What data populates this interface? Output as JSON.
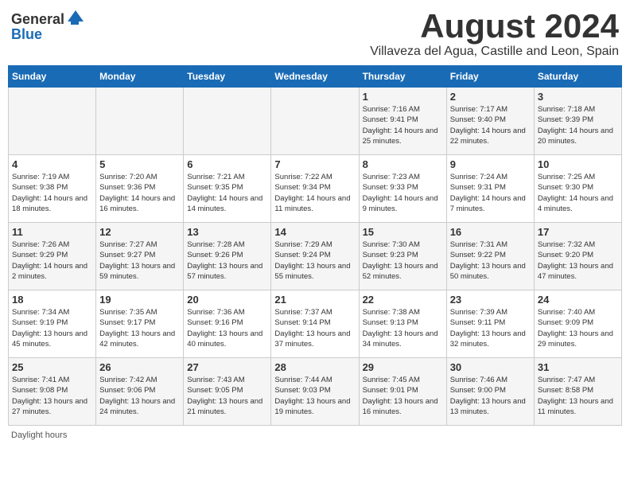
{
  "header": {
    "logo": {
      "general": "General",
      "blue": "Blue"
    },
    "title": "August 2024",
    "location": "Villaveza del Agua, Castille and Leon, Spain"
  },
  "calendar": {
    "days_of_week": [
      "Sunday",
      "Monday",
      "Tuesday",
      "Wednesday",
      "Thursday",
      "Friday",
      "Saturday"
    ],
    "weeks": [
      [
        {
          "day": "",
          "info": ""
        },
        {
          "day": "",
          "info": ""
        },
        {
          "day": "",
          "info": ""
        },
        {
          "day": "",
          "info": ""
        },
        {
          "day": "1",
          "info": "Sunrise: 7:16 AM\nSunset: 9:41 PM\nDaylight: 14 hours and 25 minutes."
        },
        {
          "day": "2",
          "info": "Sunrise: 7:17 AM\nSunset: 9:40 PM\nDaylight: 14 hours and 22 minutes."
        },
        {
          "day": "3",
          "info": "Sunrise: 7:18 AM\nSunset: 9:39 PM\nDaylight: 14 hours and 20 minutes."
        }
      ],
      [
        {
          "day": "4",
          "info": "Sunrise: 7:19 AM\nSunset: 9:38 PM\nDaylight: 14 hours and 18 minutes."
        },
        {
          "day": "5",
          "info": "Sunrise: 7:20 AM\nSunset: 9:36 PM\nDaylight: 14 hours and 16 minutes."
        },
        {
          "day": "6",
          "info": "Sunrise: 7:21 AM\nSunset: 9:35 PM\nDaylight: 14 hours and 14 minutes."
        },
        {
          "day": "7",
          "info": "Sunrise: 7:22 AM\nSunset: 9:34 PM\nDaylight: 14 hours and 11 minutes."
        },
        {
          "day": "8",
          "info": "Sunrise: 7:23 AM\nSunset: 9:33 PM\nDaylight: 14 hours and 9 minutes."
        },
        {
          "day": "9",
          "info": "Sunrise: 7:24 AM\nSunset: 9:31 PM\nDaylight: 14 hours and 7 minutes."
        },
        {
          "day": "10",
          "info": "Sunrise: 7:25 AM\nSunset: 9:30 PM\nDaylight: 14 hours and 4 minutes."
        }
      ],
      [
        {
          "day": "11",
          "info": "Sunrise: 7:26 AM\nSunset: 9:29 PM\nDaylight: 14 hours and 2 minutes."
        },
        {
          "day": "12",
          "info": "Sunrise: 7:27 AM\nSunset: 9:27 PM\nDaylight: 13 hours and 59 minutes."
        },
        {
          "day": "13",
          "info": "Sunrise: 7:28 AM\nSunset: 9:26 PM\nDaylight: 13 hours and 57 minutes."
        },
        {
          "day": "14",
          "info": "Sunrise: 7:29 AM\nSunset: 9:24 PM\nDaylight: 13 hours and 55 minutes."
        },
        {
          "day": "15",
          "info": "Sunrise: 7:30 AM\nSunset: 9:23 PM\nDaylight: 13 hours and 52 minutes."
        },
        {
          "day": "16",
          "info": "Sunrise: 7:31 AM\nSunset: 9:22 PM\nDaylight: 13 hours and 50 minutes."
        },
        {
          "day": "17",
          "info": "Sunrise: 7:32 AM\nSunset: 9:20 PM\nDaylight: 13 hours and 47 minutes."
        }
      ],
      [
        {
          "day": "18",
          "info": "Sunrise: 7:34 AM\nSunset: 9:19 PM\nDaylight: 13 hours and 45 minutes."
        },
        {
          "day": "19",
          "info": "Sunrise: 7:35 AM\nSunset: 9:17 PM\nDaylight: 13 hours and 42 minutes."
        },
        {
          "day": "20",
          "info": "Sunrise: 7:36 AM\nSunset: 9:16 PM\nDaylight: 13 hours and 40 minutes."
        },
        {
          "day": "21",
          "info": "Sunrise: 7:37 AM\nSunset: 9:14 PM\nDaylight: 13 hours and 37 minutes."
        },
        {
          "day": "22",
          "info": "Sunrise: 7:38 AM\nSunset: 9:13 PM\nDaylight: 13 hours and 34 minutes."
        },
        {
          "day": "23",
          "info": "Sunrise: 7:39 AM\nSunset: 9:11 PM\nDaylight: 13 hours and 32 minutes."
        },
        {
          "day": "24",
          "info": "Sunrise: 7:40 AM\nSunset: 9:09 PM\nDaylight: 13 hours and 29 minutes."
        }
      ],
      [
        {
          "day": "25",
          "info": "Sunrise: 7:41 AM\nSunset: 9:08 PM\nDaylight: 13 hours and 27 minutes."
        },
        {
          "day": "26",
          "info": "Sunrise: 7:42 AM\nSunset: 9:06 PM\nDaylight: 13 hours and 24 minutes."
        },
        {
          "day": "27",
          "info": "Sunrise: 7:43 AM\nSunset: 9:05 PM\nDaylight: 13 hours and 21 minutes."
        },
        {
          "day": "28",
          "info": "Sunrise: 7:44 AM\nSunset: 9:03 PM\nDaylight: 13 hours and 19 minutes."
        },
        {
          "day": "29",
          "info": "Sunrise: 7:45 AM\nSunset: 9:01 PM\nDaylight: 13 hours and 16 minutes."
        },
        {
          "day": "30",
          "info": "Sunrise: 7:46 AM\nSunset: 9:00 PM\nDaylight: 13 hours and 13 minutes."
        },
        {
          "day": "31",
          "info": "Sunrise: 7:47 AM\nSunset: 8:58 PM\nDaylight: 13 hours and 11 minutes."
        }
      ]
    ]
  },
  "footer": {
    "daylight_label": "Daylight hours"
  }
}
